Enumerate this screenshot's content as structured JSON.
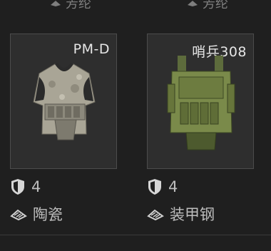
{
  "items": [
    {
      "name": "PM-D",
      "level": "4",
      "material": "陶瓷",
      "material_icon": "armor-plate-icon",
      "level_icon": "shield-icon",
      "top_material": "芳纶"
    },
    {
      "name": "哨兵308",
      "level": "4",
      "material": "装甲钢",
      "material_icon": "armor-plate-icon",
      "level_icon": "shield-icon",
      "top_material": "芳纶"
    }
  ],
  "colors": {
    "background": "#1f1f1f",
    "card": "#2e2e2e",
    "card_border": "#4c4c4c",
    "text": "#bdbdbd"
  }
}
